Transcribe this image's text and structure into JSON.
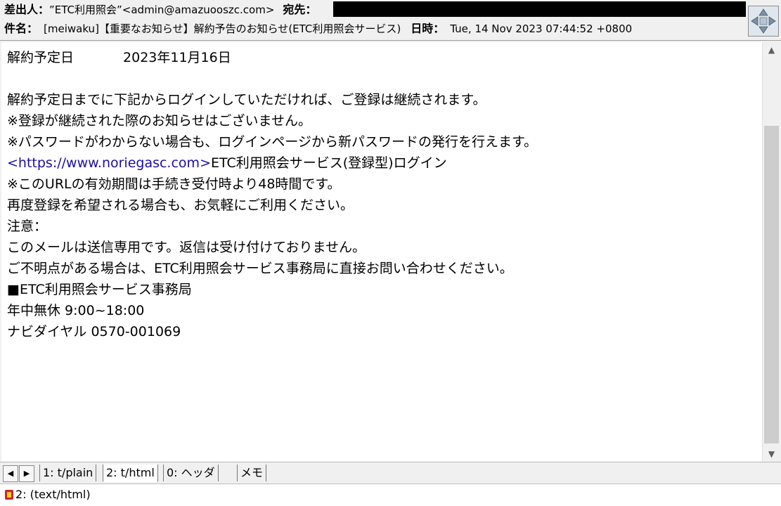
{
  "header": {
    "from_label": "差出人：",
    "from_value": "”ETC利用照会”<admin@amazuooszc.com>",
    "to_label": "宛先：",
    "subject_label": "件名：",
    "subject_value": "[meiwaku]【重要なお知らせ】解約予告のお知らせ(ETC利用照会サービス)",
    "date_label": "日時：",
    "date_value": "Tue, 14 Nov 2023 07:44:52 +0800"
  },
  "body": {
    "line1_label": "解約予定日",
    "line1_value": "2023年11月16日",
    "line2": "解約予定日までに下記からログインしていただければ、ご登録は継続されます。",
    "line3": "※登録が継続された際のお知らせはございません。",
    "line4": "※パスワードがわからない場合も、ログインページから新パスワードの発行を行えます。",
    "link_open": "<",
    "link_url": "https://www.noriegasc.com",
    "link_close": ">",
    "link_text": "ETC利用照会サービス(登録型)ログイン",
    "line6": "※このURLの有効期間は手続き受付時より48時間です。",
    "line7": "再度登録を希望される場合も、お気軽にご利用ください。",
    "line8": "注意：",
    "line9": "このメールは送信専用です。返信は受け付けておりません。",
    "line10": "ご不明点がある場合は、ETC利用照会サービス事務局に直接お問い合わせください。",
    "line11": "■ETC利用照会サービス事務局",
    "line12": "年中無休 9:00~18:00",
    "line13": "ナビダイヤル 0570-001069"
  },
  "tabs": [
    {
      "label": "1: t/plain"
    },
    {
      "label": "2: t/html"
    },
    {
      "label": "0: ヘッダ"
    },
    {
      "label": "メモ"
    }
  ],
  "status": {
    "text": "2: (text/html)"
  },
  "scrollbar": {
    "position_fraction": 0.2
  }
}
